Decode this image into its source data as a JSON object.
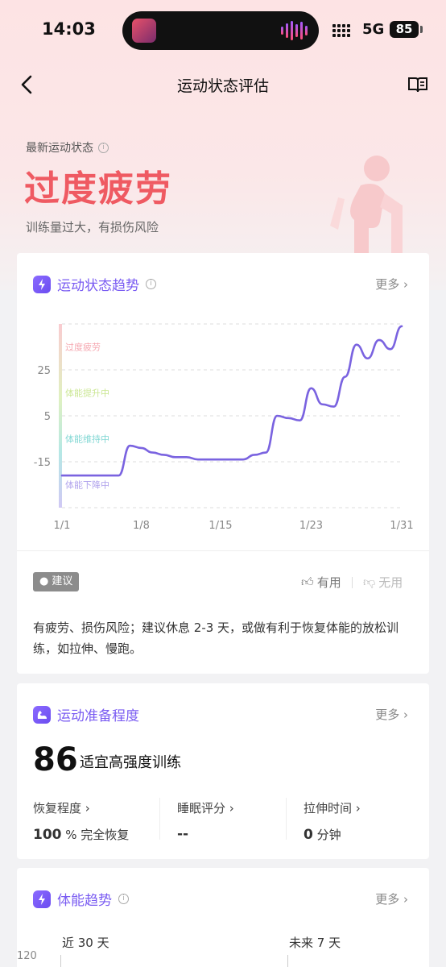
{
  "status_bar": {
    "time": "14:03",
    "network": "5G",
    "battery": "85"
  },
  "nav": {
    "title": "运动状态评估"
  },
  "hero": {
    "label": "最新运动状态",
    "status": "过度疲劳",
    "description": "训练量过大，有损伤风险",
    "figure_icon": "fatigued-person-icon"
  },
  "trend_card": {
    "title": "运动状态趋势",
    "more": "更多",
    "chart_data": {
      "type": "line",
      "y_ticks": [
        "25",
        "5",
        "-15"
      ],
      "x_ticks": [
        "1/1",
        "1/8",
        "1/15",
        "1/23",
        "1/31"
      ],
      "zones": [
        "过度疲劳",
        "体能提升中",
        "体能维持中",
        "体能下降中"
      ],
      "zone_colors": [
        "#ef6b7a",
        "#a6d64a",
        "#2bbdb5",
        "#7a63e0"
      ],
      "ylim": [
        -35,
        45
      ],
      "x": [
        1,
        2,
        3,
        4,
        5,
        6,
        7,
        8,
        9,
        10,
        11,
        12,
        13,
        14,
        15,
        16,
        17,
        18,
        19,
        20,
        21,
        22,
        23,
        24,
        25,
        26,
        27,
        28,
        29,
        30,
        31
      ],
      "values": [
        -21,
        -21,
        -21,
        -21,
        -21,
        -21,
        -8,
        -9,
        -11,
        -12,
        -13,
        -13,
        -14,
        -14,
        -14,
        -14,
        -14,
        -12,
        -11,
        5,
        4,
        3,
        17,
        10,
        9,
        22,
        36,
        30,
        38,
        34,
        44
      ]
    },
    "advice_tag": "建议",
    "useful": "有用",
    "useless": "无用",
    "advice": "有疲劳、损伤风险；建议休息 2-3 天，或做有利于恢复体能的放松训练，如拉伸、慢跑。"
  },
  "readiness_card": {
    "title": "运动准备程度",
    "more": "更多",
    "score": "86",
    "score_desc": "适宜高强度训练",
    "metrics": [
      {
        "label": "恢复程度",
        "value": "100",
        "unit": "% 完全恢复"
      },
      {
        "label": "睡眠评分",
        "value": "--",
        "unit": ""
      },
      {
        "label": "拉伸时间",
        "value": "0",
        "unit": "分钟"
      }
    ]
  },
  "fitness_card": {
    "title": "体能趋势",
    "more": "更多",
    "tab_past": "近 30 天",
    "tab_future": "未来 7 天",
    "y_top": "120"
  }
}
